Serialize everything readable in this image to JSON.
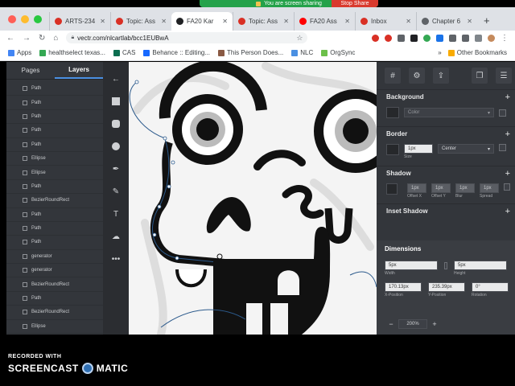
{
  "screen_share": {
    "message": "You are screen sharing",
    "stop_label": "Stop Share"
  },
  "browser": {
    "tabs": [
      {
        "label": "ARTS-234",
        "color": "#d93025",
        "active": false
      },
      {
        "label": "Topic: Ass",
        "color": "#d93025",
        "active": false
      },
      {
        "label": "FA20 Kar",
        "color": "#202124",
        "active": true
      },
      {
        "label": "Topic: Ass",
        "color": "#d93025",
        "active": false
      },
      {
        "label": "FA20 Ass",
        "color": "#ff0000",
        "active": false
      },
      {
        "label": "Inbox",
        "color": "#d93025",
        "active": false
      },
      {
        "label": "Chapter 6",
        "color": "#5f6368",
        "active": false
      }
    ],
    "new_tab": "+",
    "address": "vectr.com/nlcartlab/bcc1EUBwA",
    "bookmarks": [
      {
        "label": "Apps",
        "color": "#4285f4"
      },
      {
        "label": "healthselect texas...",
        "color": "#34a853"
      },
      {
        "label": "CAS",
        "color": "#0b6e4f"
      },
      {
        "label": "Behance :: Editing...",
        "color": "#1769ff"
      },
      {
        "label": "This Person Does...",
        "color": "#8a5a44"
      },
      {
        "label": "NLC",
        "color": "#4a90e2"
      },
      {
        "label": "OrgSync",
        "color": "#6cc04a"
      }
    ],
    "bookmarks_more": "»",
    "other_bookmarks": "Other Bookmarks"
  },
  "layers_panel": {
    "tab_pages": "Pages",
    "tab_layers": "Layers",
    "items": [
      "Path",
      "Path",
      "Path",
      "Path",
      "Path",
      "Ellipse",
      "Ellipse",
      "Path",
      "BezierRoundRect",
      "Path",
      "Path",
      "Path",
      "generator",
      "generator",
      "BezierRoundRect",
      "Path",
      "BezierRoundRect",
      "Ellipse"
    ]
  },
  "properties": {
    "background_title": "Background",
    "background_color_placeholder": "Color",
    "border_title": "Border",
    "border_size": "1px",
    "border_size_label": "Size",
    "border_position": "Center",
    "shadow_title": "Shadow",
    "shadow_fields": [
      {
        "value": "1px",
        "label": "Offset X"
      },
      {
        "value": "1px",
        "label": "Offset Y"
      },
      {
        "value": "1px",
        "label": "Blur"
      },
      {
        "value": "1px",
        "label": "Spread"
      }
    ],
    "inset_shadow_title": "Inset Shadow",
    "dimensions_title": "Dimensions",
    "width_value": "5px",
    "width_label": "Width",
    "height_value": "5px",
    "height_label": "Height",
    "x_value": "170.13px",
    "x_label": "X-Position",
    "y_value": "235.39px",
    "y_label": "Y-Position",
    "rotation_value": "0°",
    "rotation_label": "Rotation",
    "zoom_value": "200%"
  },
  "watermark": {
    "line1": "RECORDED WITH",
    "line2a": "SCREENCAST",
    "line2b": "MATIC"
  }
}
